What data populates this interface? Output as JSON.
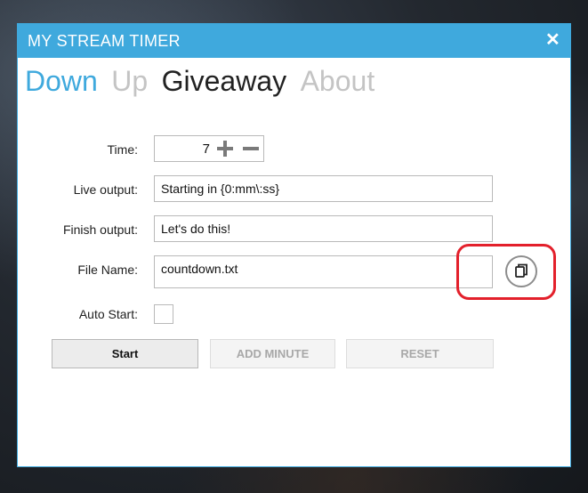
{
  "window": {
    "title": "MY STREAM TIMER",
    "close_glyph": "✕",
    "accent_color": "#3fa9dd"
  },
  "tabs": [
    {
      "label": "Down",
      "state": "accent"
    },
    {
      "label": "Up",
      "state": "inactive"
    },
    {
      "label": "Giveaway",
      "state": "active"
    },
    {
      "label": "About",
      "state": "inactive"
    }
  ],
  "form": {
    "time": {
      "label": "Time:",
      "value": "7",
      "increment_icon": "plus-icon",
      "decrement_icon": "minus-icon"
    },
    "live_output": {
      "label": "Live output:",
      "value": "Starting in {0:mm\\:ss}"
    },
    "finish_output": {
      "label": "Finish output:",
      "value": "Let's do this!"
    },
    "file_name": {
      "label": "File Name:",
      "value": "countdown.txt",
      "copy_icon": "copy-icon"
    },
    "auto_start": {
      "label": "Auto Start:",
      "checked": false
    }
  },
  "buttons": {
    "start": "Start",
    "add_minute": "ADD MINUTE",
    "reset": "RESET"
  },
  "annotation": {
    "color": "#e3202b"
  }
}
